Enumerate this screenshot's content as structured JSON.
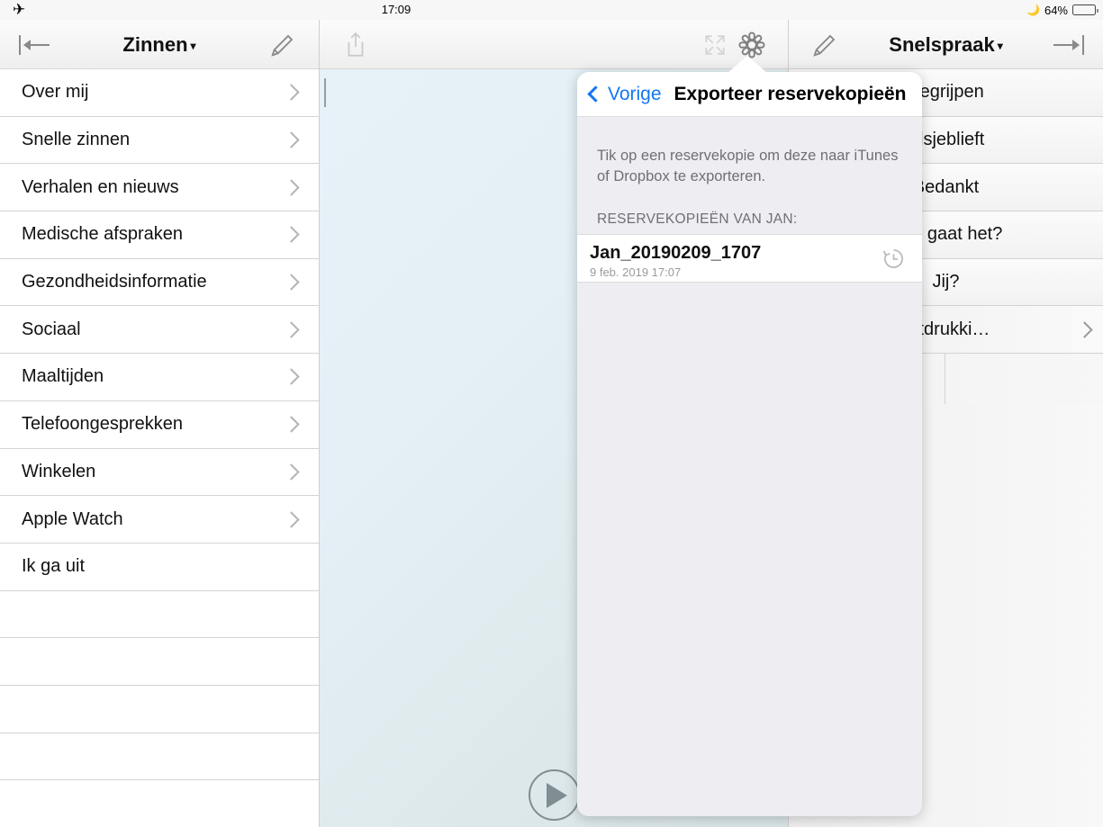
{
  "status_bar": {
    "airplane_icon": "airplane-icon",
    "time": "17:09",
    "moon_icon": "moon-icon",
    "battery_percent": "64%",
    "battery_level": 64
  },
  "left_pane": {
    "toolbar": {
      "back_icon": "arrow-to-bar-left-icon",
      "title": "Zinnen",
      "caret": "▾",
      "edit_icon": "pencil-icon"
    },
    "items": [
      {
        "label": "Over mij",
        "chevron": true
      },
      {
        "label": "Snelle zinnen",
        "chevron": true
      },
      {
        "label": "Verhalen en nieuws",
        "chevron": true
      },
      {
        "label": "Medische afspraken",
        "chevron": true
      },
      {
        "label": "Gezondheidsinformatie",
        "chevron": true
      },
      {
        "label": "Sociaal",
        "chevron": true
      },
      {
        "label": "Maaltijden",
        "chevron": true
      },
      {
        "label": "Telefoongesprekken",
        "chevron": true
      },
      {
        "label": "Winkelen",
        "chevron": true
      },
      {
        "label": "Apple Watch",
        "chevron": true
      },
      {
        "label": "Ik ga uit",
        "chevron": false
      },
      {
        "label": "",
        "chevron": false
      },
      {
        "label": "",
        "chevron": false
      },
      {
        "label": "",
        "chevron": false
      },
      {
        "label": "",
        "chevron": false
      },
      {
        "label": "",
        "chevron": false
      }
    ]
  },
  "center_pane": {
    "toolbar": {
      "share_icon": "share-icon",
      "expand_icon": "expand-icon",
      "settings_icon": "gear-icon"
    },
    "text_value": "",
    "play_icon": "play-icon"
  },
  "right_pane": {
    "toolbar": {
      "edit_icon": "pencil-icon",
      "title": "Snelspraak",
      "caret": "▾",
      "forward_icon": "arrow-to-bar-right-icon"
    },
    "items": [
      {
        "label": "Begrijpen",
        "chevron": false
      },
      {
        "label": "Alsjeblieft",
        "chevron": false
      },
      {
        "label": "Bedankt",
        "chevron": false
      },
      {
        "label": "Hoe gaat het?",
        "chevron": false
      },
      {
        "label": "Jij?",
        "chevron": false
      },
      {
        "label": "Uitdrukki…",
        "chevron": true
      }
    ]
  },
  "popover": {
    "back_label": "Vorige",
    "back_icon": "chevron-left-icon",
    "title": "Exporteer reservekopieën",
    "description": "Tik op een reservekopie om deze naar iTunes of Dropbox te exporteren.",
    "section_header": "RESERVEKOPIEËN VAN JAN:",
    "items": [
      {
        "title": "Jan_20190209_1707",
        "subtitle": "9 feb. 2019 17:07",
        "icon": "history-clock-icon"
      }
    ]
  },
  "colors": {
    "accent_blue": "#1278f3",
    "separator": "#d4d4d4",
    "popover_bg": "#eeeef2",
    "center_bg_start": "#e6f2f8",
    "center_bg_end": "#d8e3e6",
    "muted_text": "#6f6f74"
  }
}
